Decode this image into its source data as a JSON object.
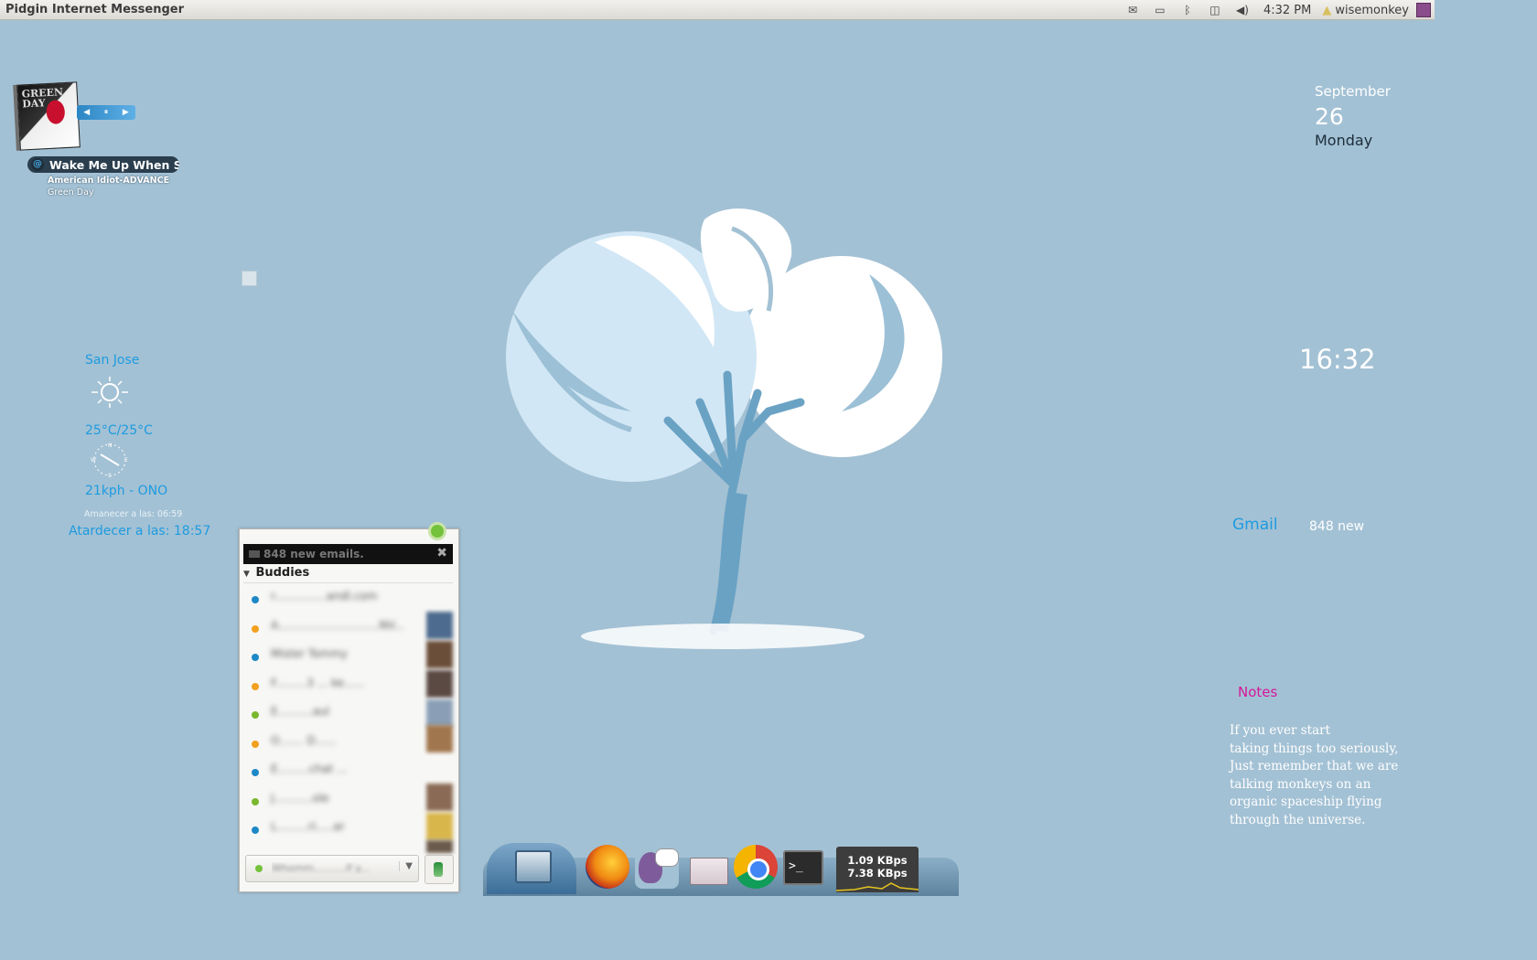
{
  "topbar": {
    "app_title": "Pidgin Internet Messenger",
    "clock": "4:32 PM",
    "username": "wisemonkey",
    "tray_icons": [
      "mail-icon",
      "battery-icon",
      "bluetooth-icon",
      "network-icon",
      "volume-icon"
    ]
  },
  "music": {
    "album_art_text": "GREEN DAY",
    "song_title": "Wake Me Up When Se",
    "album": "American Idiot-ADVANCE",
    "artist": "Green Day",
    "controls": [
      "prev",
      "pause",
      "next"
    ]
  },
  "weather": {
    "city": "San Jose",
    "condition_icon": "sun-icon",
    "temperature": "25°C/25°C",
    "wind": "21kph - ONO",
    "sunrise": "Amanecer a las: 06:59",
    "sunset": "Atardecer a las: 18:57"
  },
  "date": {
    "month": "September",
    "day": "26",
    "weekday": "Monday"
  },
  "desktop_clock": "16:32",
  "gmail": {
    "label": "Gmail",
    "count": "848 new"
  },
  "notes": {
    "title": "Notes",
    "lines": [
      "If you ever start",
      "taking things too seriously,",
      "Just remember that we are",
      "talking monkeys on an",
      "organic spaceship flying",
      "through the universe."
    ]
  },
  "pidgin": {
    "mail_notice": "848 new emails.",
    "group_label": "Buddies",
    "buddies": [
      {
        "status_color": "#1e88c7",
        "name": "r...............andl.com"
      },
      {
        "status_color": "#f2a01f",
        "name": "A.............................NV..."
      },
      {
        "status_color": "#1e88c7",
        "name": "Mister Tommy"
      },
      {
        "status_color": "#f2a01f",
        "name": "F.........3 ... ke......"
      },
      {
        "status_color": "#7ab82e",
        "name": "E..........aul"
      },
      {
        "status_color": "#f2a01f",
        "name": "O....... D......"
      },
      {
        "status_color": "#1e88c7",
        "name": "E.........chat ..."
      },
      {
        "status_color": "#7ab82e",
        "name": "J...........ole"
      },
      {
        "status_color": "#1e88c7",
        "name": "L.........ri.....ar"
      }
    ],
    "status_text": "Whomm..........lf y...",
    "thumb_colors": [
      "#4d6b8e",
      "#6a4e3a",
      "#5b4a44",
      "#8a9fb6",
      "#a0764e",
      "#8a6a55",
      "#d9b64c",
      "#6b5b4b"
    ]
  },
  "dock": {
    "items": [
      "home-icon",
      "firefox-icon",
      "pidgin-icon",
      "folder-icon",
      "chrome-icon",
      "terminal-icon"
    ],
    "terminal_glyph": ">_",
    "net_down": "1.09 KBps",
    "net_up": "7.38 KBps"
  }
}
